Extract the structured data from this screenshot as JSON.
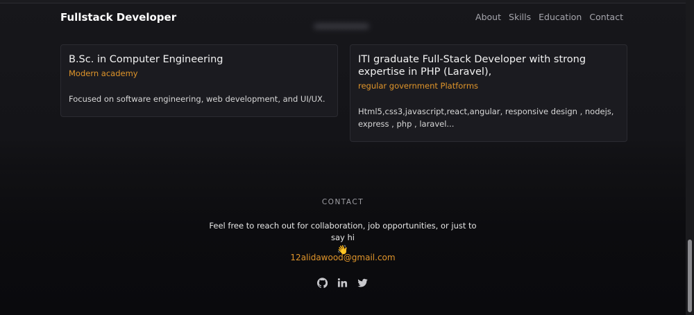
{
  "header": {
    "brand": "Fullstack Developer",
    "nav": [
      "About",
      "Skills",
      "Education",
      "Contact"
    ]
  },
  "education": {
    "cards": [
      {
        "title": "B.Sc. in Computer Engineering",
        "institution": "Modern academy",
        "description": "Focused on software engineering, web development, and UI/UX."
      },
      {
        "title": "ITI graduate Full-Stack Developer with strong expertise in PHP (Laravel),",
        "institution": "regular government Platforms",
        "description": "Html5,css3,javascript,react,angular, responsive design , nodejs, express , php , laravel..."
      }
    ]
  },
  "contact": {
    "heading": "CONTACT",
    "text": "Feel free to reach out for collaboration, job opportunities, or just to say hi",
    "emoji": "👋",
    "email": "12alidawood@gmail.com",
    "social_icons": [
      "github-icon",
      "linkedin-icon",
      "twitter-icon"
    ]
  },
  "colors": {
    "accent": "#e0952a",
    "background": "#0d0d10",
    "card_background": "#1b1b20"
  }
}
